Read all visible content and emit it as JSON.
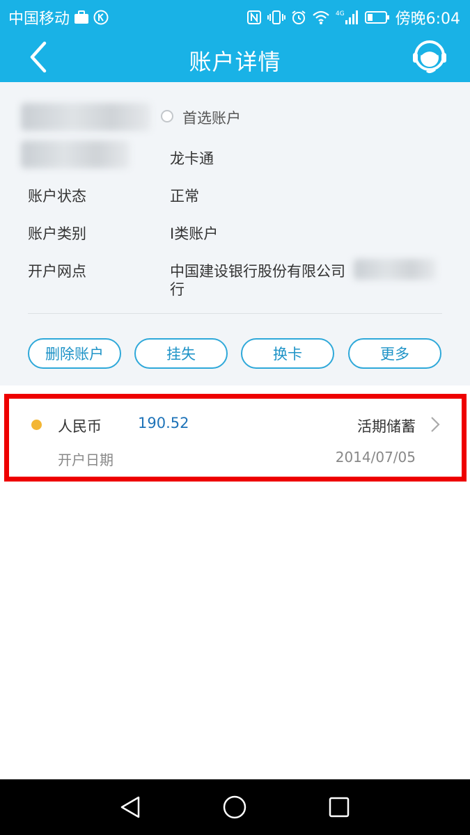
{
  "status_bar": {
    "carrier": "中国移动",
    "time": "傍晚6:04",
    "network": "4G"
  },
  "header": {
    "title": "账户详情"
  },
  "account": {
    "preferred_label": "首选账户",
    "card_type": "龙卡通",
    "rows": [
      {
        "label": "账户状态",
        "value": "正常"
      },
      {
        "label": "账户类别",
        "value": "I类账户"
      },
      {
        "label": "开户网点",
        "value_line1": "中国建设银行股份有限公司",
        "value_line2": "行"
      }
    ]
  },
  "actions": {
    "delete": "删除账户",
    "report_loss": "挂失",
    "replace_card": "换卡",
    "more": "更多"
  },
  "deposit": {
    "currency": "人民币",
    "amount": "190.52",
    "type": "活期储蓄",
    "open_date_label": "开户日期",
    "open_date": "2014/07/05"
  },
  "colors": {
    "brand": "#19b2e6",
    "button_border": "#2ea8d9",
    "amount": "#1e73b8",
    "highlight": "#ee0000",
    "dot": "#f3b634"
  }
}
